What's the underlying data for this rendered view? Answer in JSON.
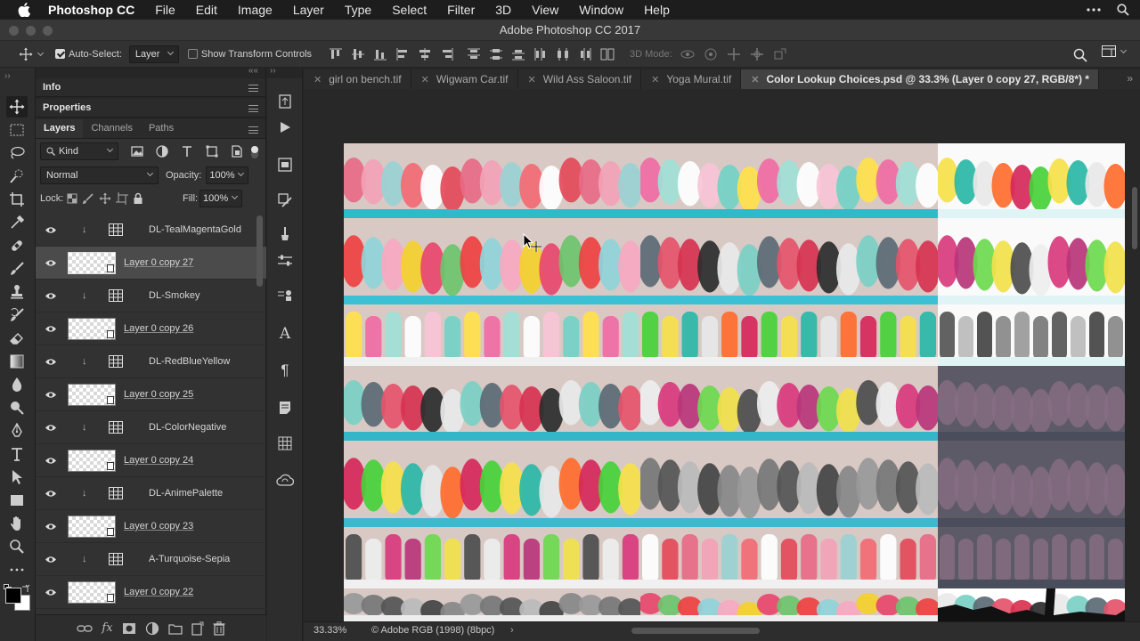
{
  "menubar": {
    "app": "Photoshop CC",
    "items": [
      "File",
      "Edit",
      "Image",
      "Layer",
      "Type",
      "Select",
      "Filter",
      "3D",
      "View",
      "Window",
      "Help"
    ]
  },
  "window": {
    "title": "Adobe Photoshop CC 2017"
  },
  "options": {
    "auto_select_label": "Auto-Select:",
    "auto_select_value": "Layer",
    "show_transform_label": "Show Transform Controls",
    "mode_3d_label": "3D Mode:"
  },
  "panels": {
    "info": "Info",
    "properties": "Properties",
    "tabs": [
      "Layers",
      "Channels",
      "Paths"
    ],
    "filter_kind": "Kind",
    "blend_mode": "Normal",
    "opacity_label": "Opacity:",
    "opacity_value": "100%",
    "lock_label": "Lock:",
    "fill_label": "Fill:",
    "fill_value": "100%",
    "layers": [
      {
        "name": "DL-TealMagentaGold",
        "kind": "adjustment"
      },
      {
        "name": "Layer 0 copy 27",
        "kind": "pixel",
        "selected": true
      },
      {
        "name": "DL-Smokey",
        "kind": "adjustment"
      },
      {
        "name": "Layer 0 copy 26",
        "kind": "pixel"
      },
      {
        "name": "DL-RedBlueYellow",
        "kind": "adjustment"
      },
      {
        "name": "Layer 0 copy 25",
        "kind": "pixel"
      },
      {
        "name": "DL-ColorNegative",
        "kind": "adjustment"
      },
      {
        "name": "Layer 0 copy 24",
        "kind": "pixel"
      },
      {
        "name": "DL-AnimePalette",
        "kind": "adjustment"
      },
      {
        "name": "Layer 0 copy 23",
        "kind": "pixel"
      },
      {
        "name": "A-Turquoise-Sepia",
        "kind": "adjustment"
      },
      {
        "name": "Layer 0 copy 22",
        "kind": "pixel"
      }
    ]
  },
  "document_tabs": [
    {
      "label": "girl on bench.tif"
    },
    {
      "label": "Wigwam Car.tif"
    },
    {
      "label": "Wild Ass Saloon.tif"
    },
    {
      "label": "Yoga Mural.tif"
    },
    {
      "label": "Color Lookup Choices.psd @ 33.3% (Layer 0 copy 27, RGB/8*) *",
      "active": true
    }
  ],
  "status": {
    "zoom": "33.33%",
    "profile": "© Adobe RGB (1998) (8bpc)"
  },
  "colors": {
    "accent": "#4b4b4b",
    "panel_bg": "#323232",
    "canvas_bg": "#282828"
  }
}
